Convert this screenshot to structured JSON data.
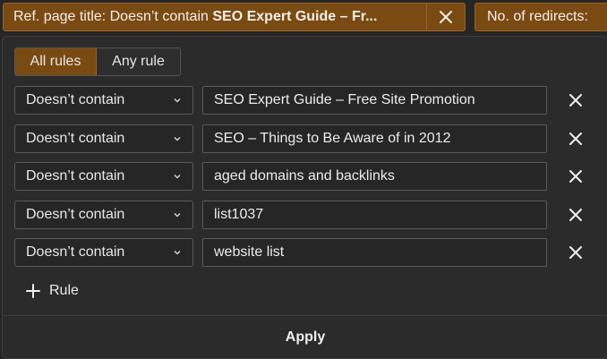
{
  "filters_bar": {
    "chip1": {
      "prefix": "Ref. page title: Doesn’t contain ",
      "value_bold": "SEO Expert Guide – Fr..."
    },
    "chip2": {
      "label": "No. of redirects:"
    }
  },
  "match_mode": {
    "options": [
      "All rules",
      "Any rule"
    ],
    "selected": "All rules"
  },
  "rules": [
    {
      "condition": "Doesn’t contain",
      "value": "SEO Expert Guide – Free Site Promotion"
    },
    {
      "condition": "Doesn’t contain",
      "value": "SEO – Things to Be Aware of in 2012"
    },
    {
      "condition": "Doesn’t contain",
      "value": "aged domains and backlinks"
    },
    {
      "condition": "Doesn’t contain",
      "value": "list1037"
    },
    {
      "condition": "Doesn’t contain",
      "value": "website list"
    }
  ],
  "add_rule_label": "Rule",
  "apply_label": "Apply",
  "icons": {
    "close": "close-icon",
    "chevron": "chevron-down-icon",
    "plus": "plus-icon"
  },
  "colors": {
    "accent": "#7a4a13",
    "background": "#2b2b2b"
  }
}
